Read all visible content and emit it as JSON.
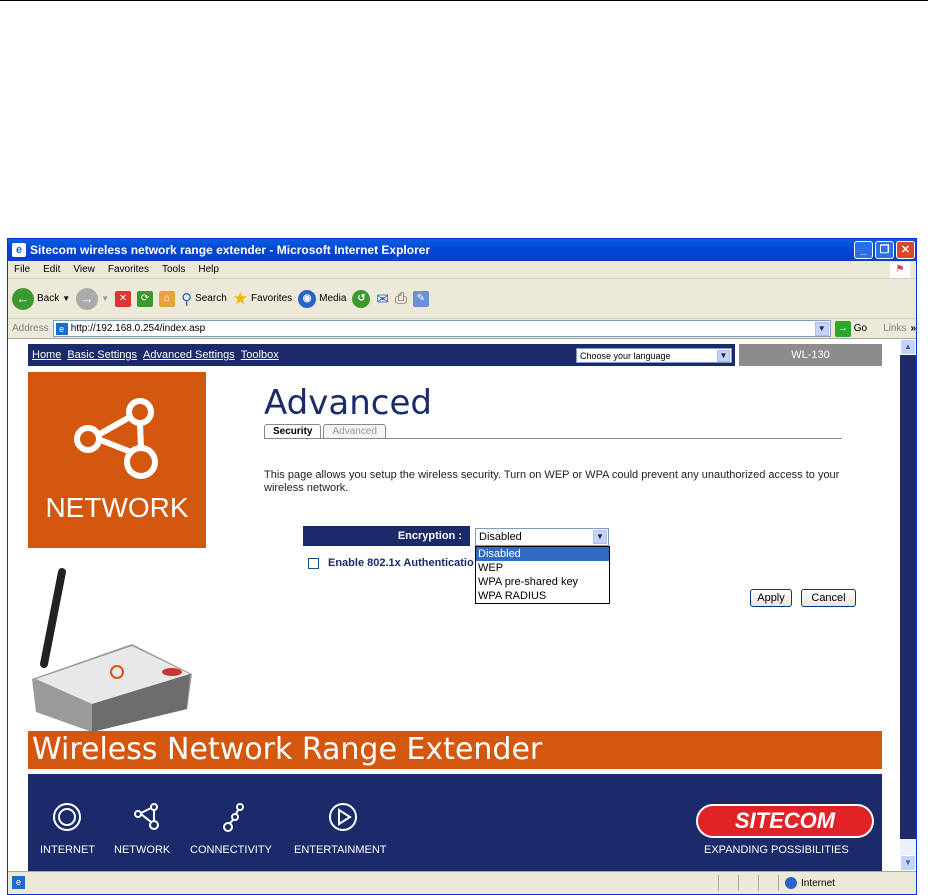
{
  "window": {
    "title": "Sitecom wireless network range extender - Microsoft Internet Explorer"
  },
  "menu": [
    "File",
    "Edit",
    "View",
    "Favorites",
    "Tools",
    "Help"
  ],
  "toolbar": {
    "back": "Back",
    "search": "Search",
    "favorites": "Favorites",
    "media": "Media"
  },
  "address": {
    "label": "Address",
    "url": "http://192.168.0.254/index.asp",
    "go": "Go",
    "links": "Links"
  },
  "nav": {
    "home": "Home",
    "basic": "Basic Settings",
    "advanced": "Advanced Settings",
    "toolbox": "Toolbox"
  },
  "language": "Choose your language",
  "model": "WL-130",
  "hero_label": "NETWORK",
  "page_title": "Advanced",
  "tabs": {
    "security": "Security",
    "advanced": "Advanced"
  },
  "description": "This page allows you setup the wireless security. Turn on WEP or WPA could prevent any unauthorized access to your wireless network.",
  "encryption": {
    "label": "Encryption :",
    "value": "Disabled",
    "options": [
      "Disabled",
      "WEP",
      "WPA pre-shared key",
      "WPA RADIUS"
    ]
  },
  "auth_label": "Enable 802.1x Authentication",
  "buttons": {
    "apply": "Apply",
    "cancel": "Cancel"
  },
  "banner": "Wireless Network Range Extender",
  "footer": {
    "items": [
      "INTERNET",
      "NETWORK",
      "CONNECTIVITY",
      "ENTERTAINMENT"
    ],
    "brand": "SITECOM",
    "tagline": "EXPANDING POSSIBILITIES"
  },
  "status": {
    "zone": "Internet"
  },
  "colors": {
    "navy": "#1b2a6b",
    "orange": "#d4570f",
    "brand_red": "#e12227"
  }
}
